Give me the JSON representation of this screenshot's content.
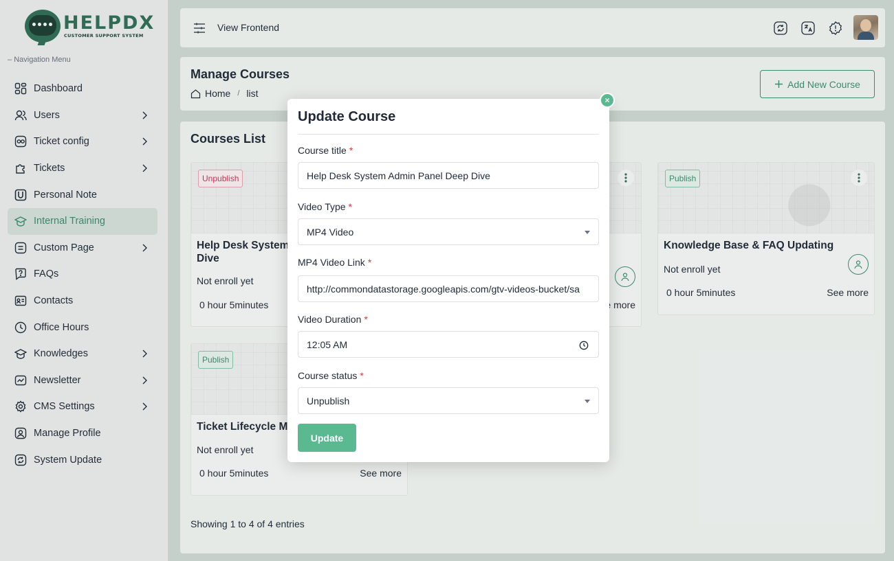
{
  "brand": {
    "name": "HELPDX",
    "tagline": "CUSTOMER SUPPORT SYSTEM"
  },
  "sidebar": {
    "heading": "Navigation Menu",
    "items": [
      {
        "label": "Dashboard",
        "icon": "dashboard-icon",
        "chevron": false,
        "active": false
      },
      {
        "label": "Users",
        "icon": "users-icon",
        "chevron": true,
        "active": false
      },
      {
        "label": "Ticket config",
        "icon": "ticket-config-icon",
        "chevron": true,
        "active": false
      },
      {
        "label": "Tickets",
        "icon": "tickets-icon",
        "chevron": true,
        "active": false
      },
      {
        "label": "Personal Note",
        "icon": "note-icon",
        "chevron": false,
        "active": false
      },
      {
        "label": "Internal Training",
        "icon": "training-icon",
        "chevron": false,
        "active": true
      },
      {
        "label": "Custom Page",
        "icon": "page-icon",
        "chevron": true,
        "active": false
      },
      {
        "label": "FAQs",
        "icon": "faq-icon",
        "chevron": false,
        "active": false
      },
      {
        "label": "Contacts",
        "icon": "contacts-icon",
        "chevron": false,
        "active": false
      },
      {
        "label": "Office Hours",
        "icon": "clock-icon",
        "chevron": false,
        "active": false
      },
      {
        "label": "Knowledges",
        "icon": "knowledge-icon",
        "chevron": true,
        "active": false
      },
      {
        "label": "Newsletter",
        "icon": "newsletter-icon",
        "chevron": true,
        "active": false
      },
      {
        "label": "CMS Settings",
        "icon": "settings-icon",
        "chevron": true,
        "active": false
      },
      {
        "label": "Manage Profile",
        "icon": "profile-icon",
        "chevron": false,
        "active": false
      },
      {
        "label": "System Update",
        "icon": "update-icon",
        "chevron": false,
        "active": false
      }
    ]
  },
  "topbar": {
    "view_frontend": "View Frontend"
  },
  "page": {
    "title": "Manage Courses",
    "breadcrumb_home": "Home",
    "breadcrumb_current": "list",
    "add_button": "Add New Course"
  },
  "courses": {
    "title": "Courses List",
    "cards": [
      {
        "badge": "Unpublish",
        "status": "unpublish",
        "title_line1": "Help Desk System",
        "title_line2": "Dive",
        "enroll": "Not enroll yet",
        "duration": "0 hour 5minutes",
        "more": ""
      },
      {
        "badge": "",
        "status": "hidden",
        "title_line1": "",
        "title_line2": "",
        "enroll": "",
        "duration": "",
        "more": "e more"
      },
      {
        "badge": "Publish",
        "status": "publish",
        "title_line1": "Knowledge Base & FAQ Updating",
        "title_line2": "",
        "enroll": "Not enroll yet",
        "duration": "0 hour 5minutes",
        "more": "See more"
      },
      {
        "badge": "Publish",
        "status": "publish",
        "title_line1": "Ticket Lifecycle Ma",
        "title_line2": "",
        "enroll": "Not enroll yet",
        "duration": "0 hour 5minutes",
        "more": "See more"
      }
    ],
    "showing": "Showing 1 to 4 of 4 entries"
  },
  "modal": {
    "title": "Update Course",
    "close": "×",
    "fields": {
      "course_title": {
        "label": "Course title",
        "value": "Help Desk System Admin Panel Deep Dive"
      },
      "video_type": {
        "label": "Video Type",
        "value": "MP4 Video"
      },
      "video_link": {
        "label": "MP4 Video Link",
        "value": "http://commondatastorage.googleapis.com/gtv-videos-bucket/sa"
      },
      "video_duration": {
        "label": "Video Duration",
        "value": "12:05 AM"
      },
      "course_status": {
        "label": "Course status",
        "value": "Unpublish"
      }
    },
    "required_mark": "*",
    "submit": "Update"
  }
}
